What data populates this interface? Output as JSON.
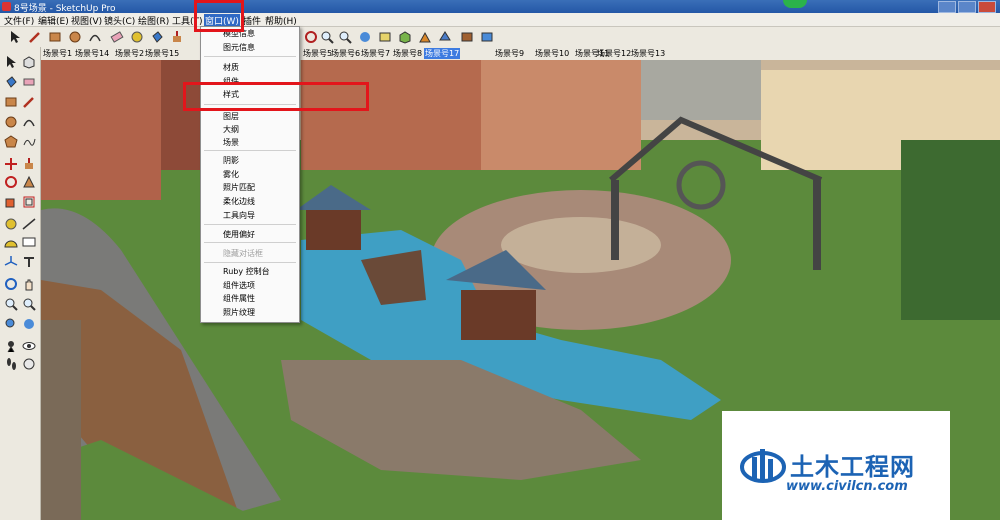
{
  "window": {
    "title": "8号场景 - SketchUp Pro"
  },
  "menubar": {
    "items": [
      "文件(F)",
      "编辑(E)",
      "视图(V)",
      "镜头(C)",
      "绘图(R)",
      "工具(T)",
      "窗口(W)",
      "插件",
      "帮助(H)"
    ]
  },
  "scene_tabs": {
    "items": [
      "场景号1",
      "场景号14",
      "场景号2",
      "场景号15",
      "场景号5",
      "场景号6",
      "场景号7",
      "场景号8",
      "场景号17",
      "场景号9",
      "场景号10",
      "场景号11",
      "场景号12",
      "场景号13"
    ],
    "active": "场景号17"
  },
  "window_menu": {
    "groups": [
      [
        "模型信息",
        "图元信息"
      ],
      [
        "材质",
        "组件",
        "样式"
      ],
      [
        "图层",
        "大纲",
        "场景"
      ],
      [
        "阴影",
        "雾化",
        "照片匹配",
        "柔化边线",
        "工具向导"
      ],
      [
        "使用偏好"
      ],
      [
        "隐藏对话框"
      ],
      [
        "Ruby 控制台",
        "组件选项",
        "组件属性",
        "照片纹理"
      ]
    ],
    "disabled": [
      "隐藏对话框"
    ],
    "highlighted": "样式"
  },
  "watermark": {
    "title": "土木工程网",
    "url": "www.civilcn.com"
  },
  "colors": {
    "highlight_box": "#e3151b",
    "title_bar": "#2457a6",
    "active_tab": "#3d7be0",
    "watermark_text": "#1c63b4"
  }
}
